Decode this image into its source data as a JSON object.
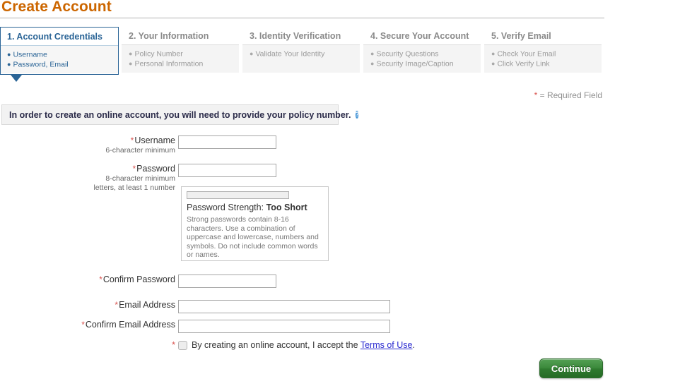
{
  "page": {
    "title": "Create Account",
    "required_note_star": "*",
    "required_note_text": "= Required Field"
  },
  "steps": [
    {
      "title": "1. Account Credentials",
      "items": [
        "Username",
        "Password, Email"
      ],
      "active": true
    },
    {
      "title": "2. Your Information",
      "items": [
        "Policy Number",
        "Personal Information"
      ],
      "active": false
    },
    {
      "title": "3. Identity Verification",
      "items": [
        "Validate Your Identity"
      ],
      "active": false
    },
    {
      "title": "4. Secure Your Account",
      "items": [
        "Security Questions",
        "Security Image/Caption"
      ],
      "active": false
    },
    {
      "title": "5. Verify Email",
      "items": [
        "Check Your Email",
        "Click Verify Link"
      ],
      "active": false
    }
  ],
  "info_banner": {
    "text": "In order to create an online account, you will need to provide your policy number.",
    "help_icon": "question-mark-icon",
    "help_glyph": "?"
  },
  "form": {
    "username": {
      "star": "*",
      "label": "Username",
      "hint": "6-character minimum",
      "value": "",
      "placeholder": ""
    },
    "password": {
      "star": "*",
      "label": "Password",
      "hint_line1": "8-character minimum",
      "hint_line2": "letters, at least 1 number",
      "value": "",
      "placeholder": ""
    },
    "confirm_password": {
      "star": "*",
      "label": "Confirm Password",
      "value": "",
      "placeholder": ""
    },
    "email": {
      "star": "*",
      "label": "Email Address",
      "value": "",
      "placeholder": ""
    },
    "confirm_email": {
      "star": "*",
      "label": "Confirm Email Address",
      "value": "",
      "placeholder": ""
    }
  },
  "password_strength": {
    "meter_percent": 0,
    "prefix": "Password Strength:",
    "level": "Too Short",
    "description": "Strong passwords contain 8-16 characters. Use a combination of uppercase and lowercase, numbers and symbols. Do not include common words or names."
  },
  "terms": {
    "star": "*",
    "checked": false,
    "text_before": "By creating an online account, I accept the",
    "link": "Terms of Use",
    "text_after": "."
  },
  "actions": {
    "continue_label": "Continue"
  },
  "colors": {
    "title_orange": "#cc6600",
    "active_blue": "#2a6496",
    "required_red": "#d9534f",
    "link_blue": "#2a2ad0",
    "button_green": "#3d8b3d",
    "help_icon_blue": "#3b8fd4"
  }
}
